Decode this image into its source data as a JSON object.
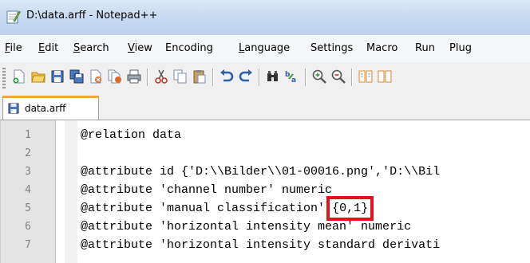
{
  "window": {
    "title": "D:\\data.arff - Notepad++",
    "app_icon": "notepad-plus-plus-icon"
  },
  "menubar": {
    "items": [
      {
        "underline": "F",
        "rest": "ile"
      },
      {
        "underline": "E",
        "rest": "dit"
      },
      {
        "underline": "S",
        "rest": "earch"
      },
      {
        "underline": "V",
        "rest": "iew"
      },
      {
        "underline": "",
        "rest": "Encoding"
      },
      {
        "underline": "L",
        "rest": "anguage"
      },
      {
        "underline": "",
        "rest": "Settings"
      },
      {
        "underline": "",
        "rest": "Macro"
      },
      {
        "underline": "",
        "rest": "Run"
      },
      {
        "underline": "",
        "rest": "Plug"
      }
    ]
  },
  "toolbar": {
    "icons": [
      "new-file-icon",
      "open-file-icon",
      "save-icon",
      "save-all-icon",
      "close-icon",
      "close-all-icon",
      "print-icon",
      "cut-icon",
      "copy-icon",
      "paste-icon",
      "undo-icon",
      "redo-icon",
      "find-icon",
      "replace-icon",
      "zoom-in-icon",
      "zoom-out-icon",
      "sync-vertical-icon",
      "sync-horizontal-icon"
    ]
  },
  "tabs": [
    {
      "label": "data.arff",
      "active": true
    }
  ],
  "editor": {
    "lines": [
      {
        "num": "1",
        "text": "@relation data"
      },
      {
        "num": "2",
        "text": ""
      },
      {
        "num": "3",
        "text": "@attribute id {'D:\\\\Bilder\\\\01-00016.png','D:\\\\Bil"
      },
      {
        "num": "4",
        "text": "@attribute 'channel number' numeric"
      },
      {
        "num": "5",
        "text": "@attribute 'manual classification' ",
        "highlight": "{0,1}"
      },
      {
        "num": "6",
        "text": "@attribute 'horizontal intensity mean' numeric"
      },
      {
        "num": "7",
        "text": "@attribute 'horizontal intensity standard derivati"
      }
    ]
  },
  "colors": {
    "highlight_box": "#e8101a",
    "active_tab_accent": "#f6a637"
  }
}
